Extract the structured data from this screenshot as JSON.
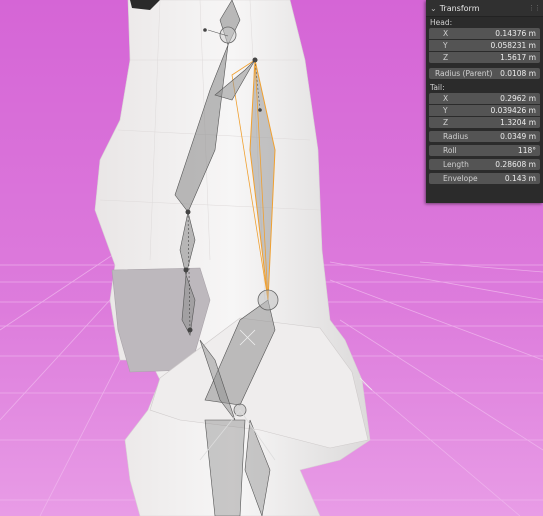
{
  "panel": {
    "title": "Transform",
    "head_label": "Head:",
    "head": [
      {
        "axis": "X",
        "value": "0.14376 m"
      },
      {
        "axis": "Y",
        "value": "0.058231 m"
      },
      {
        "axis": "Z",
        "value": "1.5617 m"
      }
    ],
    "radius_parent": {
      "label": "Radius (Parent)",
      "value": "0.0108 m"
    },
    "tail_label": "Tail:",
    "tail": [
      {
        "axis": "X",
        "value": "0.2962 m"
      },
      {
        "axis": "Y",
        "value": "0.039426 m"
      },
      {
        "axis": "Z",
        "value": "1.3204 m"
      }
    ],
    "radius": {
      "label": "Radius",
      "value": "0.0349 m"
    },
    "roll": {
      "label": "Roll",
      "value": "118°"
    },
    "length": {
      "label": "Length",
      "value": "0.28608 m"
    },
    "envelope": {
      "label": "Envelope",
      "value": "0.143 m"
    }
  },
  "colors": {
    "background_top": "#d86ad8",
    "background_bottom": "#e58fe5",
    "mesh": "#f1efef",
    "bone": "#8f8f8f",
    "bone_selected_outline": "#f0a030",
    "panel_bg": "#2b2b2b",
    "field_bg": "#545454"
  }
}
